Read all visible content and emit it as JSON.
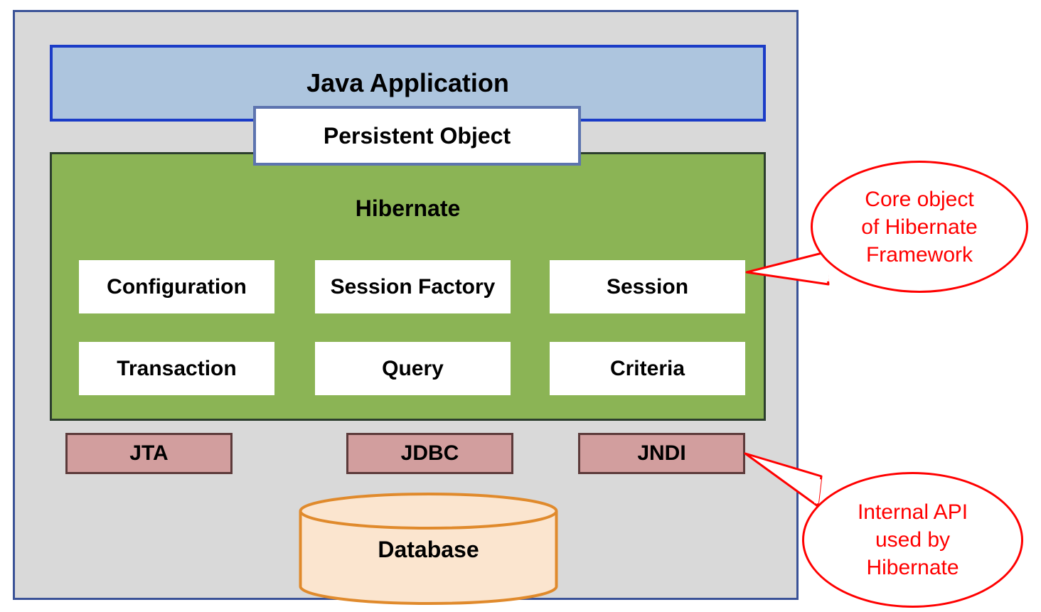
{
  "outer": {
    "java_app": "Java Application",
    "persistent": "Persistent Object",
    "hibernate": {
      "title": "Hibernate",
      "boxes": [
        "Configuration",
        "Session Factory",
        "Session",
        "Transaction",
        "Query",
        "Criteria"
      ]
    },
    "apis": [
      "JTA",
      "JDBC",
      "JNDI"
    ],
    "database": "Database"
  },
  "callouts": {
    "core": "Core object\nof Hibernate\nFramework",
    "internal": "Internal API\nused by\nHibernate"
  }
}
